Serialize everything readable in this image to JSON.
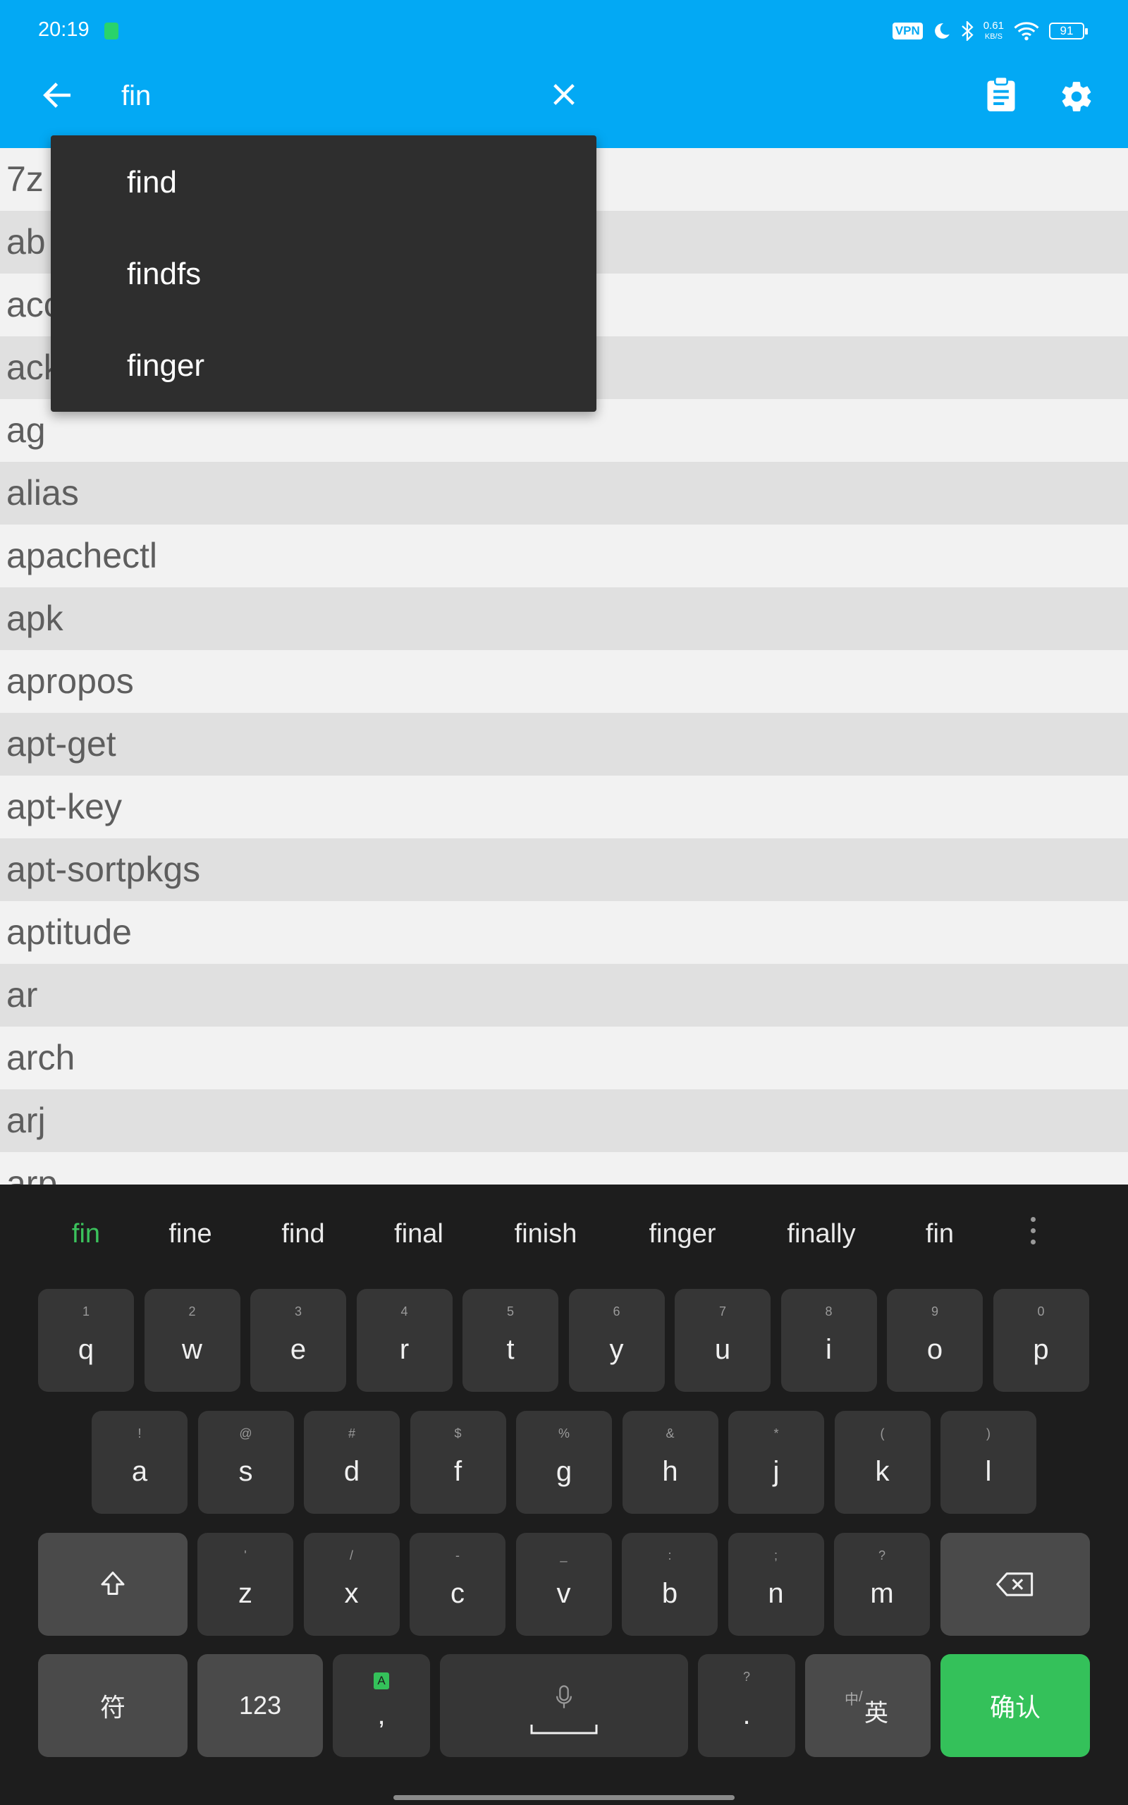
{
  "status_bar": {
    "time": "20:19",
    "vpn": "VPN",
    "net_speed_value": "0.61",
    "net_speed_unit": "KB/S",
    "battery": "91"
  },
  "app_bar": {
    "search_value": "fin",
    "color": "#03a9f4"
  },
  "suggestions": [
    "find",
    "findfs",
    "finger"
  ],
  "commands": [
    "7z",
    "ab",
    "acc",
    "ack",
    "ag",
    "alias",
    "apachectl",
    "apk",
    "apropos",
    "apt-get",
    "apt-key",
    "apt-sortpkgs",
    "aptitude",
    "ar",
    "arch",
    "arj",
    "arp"
  ],
  "keyboard": {
    "candidates": [
      "fin",
      "fine",
      "find",
      "final",
      "finish",
      "finger",
      "finally",
      "fin"
    ],
    "row1": [
      {
        "hint": "1",
        "key": "q"
      },
      {
        "hint": "2",
        "key": "w"
      },
      {
        "hint": "3",
        "key": "e"
      },
      {
        "hint": "4",
        "key": "r"
      },
      {
        "hint": "5",
        "key": "t"
      },
      {
        "hint": "6",
        "key": "y"
      },
      {
        "hint": "7",
        "key": "u"
      },
      {
        "hint": "8",
        "key": "i"
      },
      {
        "hint": "9",
        "key": "o"
      },
      {
        "hint": "0",
        "key": "p"
      }
    ],
    "row2": [
      {
        "hint": "!",
        "key": "a"
      },
      {
        "hint": "@",
        "key": "s"
      },
      {
        "hint": "#",
        "key": "d"
      },
      {
        "hint": "$",
        "key": "f"
      },
      {
        "hint": "%",
        "key": "g"
      },
      {
        "hint": "&",
        "key": "h"
      },
      {
        "hint": "*",
        "key": "j"
      },
      {
        "hint": "(",
        "key": "k"
      },
      {
        "hint": ")",
        "key": "l"
      }
    ],
    "row3": [
      {
        "hint": "'",
        "key": "z"
      },
      {
        "hint": "/",
        "key": "x"
      },
      {
        "hint": "-",
        "key": "c"
      },
      {
        "hint": "_",
        "key": "v"
      },
      {
        "hint": ":",
        "key": "b"
      },
      {
        "hint": ";",
        "key": "n"
      },
      {
        "hint": "?",
        "key": "m"
      }
    ],
    "symbols_label": "符",
    "numbers_label": "123",
    "comma_key": ",",
    "comma_hint": "A",
    "period_key": ".",
    "period_hint": "?",
    "lang_small": "中",
    "lang_main": "英",
    "confirm_label": "确认",
    "accent_color": "#34c15a"
  }
}
